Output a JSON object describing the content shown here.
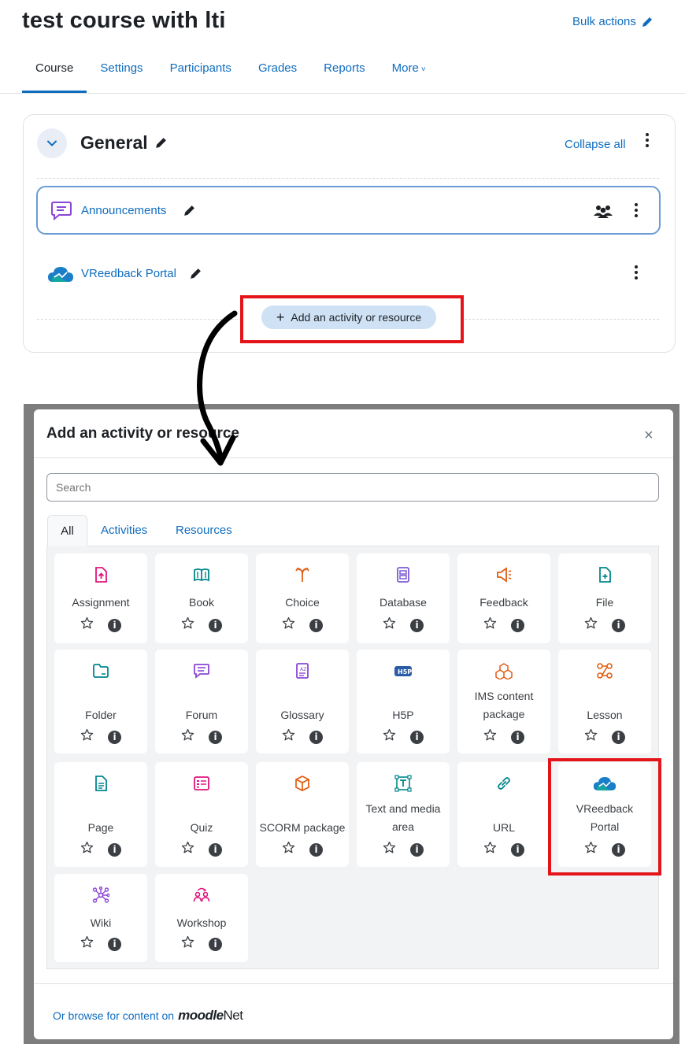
{
  "course": {
    "title": "test course with lti",
    "bulk_actions": "Bulk actions",
    "tabs": [
      {
        "label": "Course",
        "active": true
      },
      {
        "label": "Settings"
      },
      {
        "label": "Participants"
      },
      {
        "label": "Grades"
      },
      {
        "label": "Reports"
      },
      {
        "label": "More"
      }
    ]
  },
  "section": {
    "title": "General",
    "collapse_all": "Collapse all",
    "activities": [
      {
        "name": "Announcements",
        "icon": "forum-icon"
      },
      {
        "name": "VReedback Portal",
        "icon": "vreedback-cloud-icon"
      }
    ],
    "add_button": "Add an activity or resource"
  },
  "modal": {
    "title": "Add an activity or resource",
    "close": "×",
    "search_placeholder": "Search",
    "tabs": [
      "All",
      "Activities",
      "Resources"
    ],
    "items": [
      {
        "label": "Assignment",
        "icon": "assignment-icon",
        "color": "#e0147c"
      },
      {
        "label": "Book",
        "icon": "book-icon",
        "color": "#00868d"
      },
      {
        "label": "Choice",
        "icon": "choice-icon",
        "color": "#e05d10"
      },
      {
        "label": "Database",
        "icon": "database-icon",
        "color": "#7d5bd3"
      },
      {
        "label": "Feedback",
        "icon": "feedback-icon",
        "color": "#e05d10"
      },
      {
        "label": "File",
        "icon": "file-icon",
        "color": "#00868d"
      },
      {
        "label": "Folder",
        "icon": "folder-icon",
        "color": "#00868d"
      },
      {
        "label": "Forum",
        "icon": "forum-icon",
        "color": "#8b45d6"
      },
      {
        "label": "Glossary",
        "icon": "glossary-icon",
        "color": "#8b45d6"
      },
      {
        "label": "H5P",
        "icon": "h5p-icon",
        "color": "#2b5ca8"
      },
      {
        "label": "IMS content package",
        "icon": "ims-package-icon",
        "color": "#e05d10"
      },
      {
        "label": "Lesson",
        "icon": "lesson-icon",
        "color": "#e05d10"
      },
      {
        "label": "Page",
        "icon": "page-icon",
        "color": "#00868d"
      },
      {
        "label": "Quiz",
        "icon": "quiz-icon",
        "color": "#e0147c"
      },
      {
        "label": "SCORM package",
        "icon": "scorm-icon",
        "color": "#e05d10"
      },
      {
        "label": "Text and media area",
        "icon": "text-media-icon",
        "color": "#00868d"
      },
      {
        "label": "URL",
        "icon": "url-icon",
        "color": "#00868d"
      },
      {
        "label": "VReedback Portal",
        "icon": "vreedback-cloud-icon",
        "color": "#1a7ec8"
      },
      {
        "label": "Wiki",
        "icon": "wiki-icon",
        "color": "#8b45d6"
      },
      {
        "label": "Workshop",
        "icon": "workshop-icon",
        "color": "#e0147c"
      }
    ],
    "footer_text": "Or browse for content on",
    "footer_logo_moodle": "moodle",
    "footer_logo_net": "Net"
  },
  "colors": {
    "link": "#0f6cbf",
    "highlight": "#e3151a",
    "add_button_bg": "#cfe2f5"
  }
}
